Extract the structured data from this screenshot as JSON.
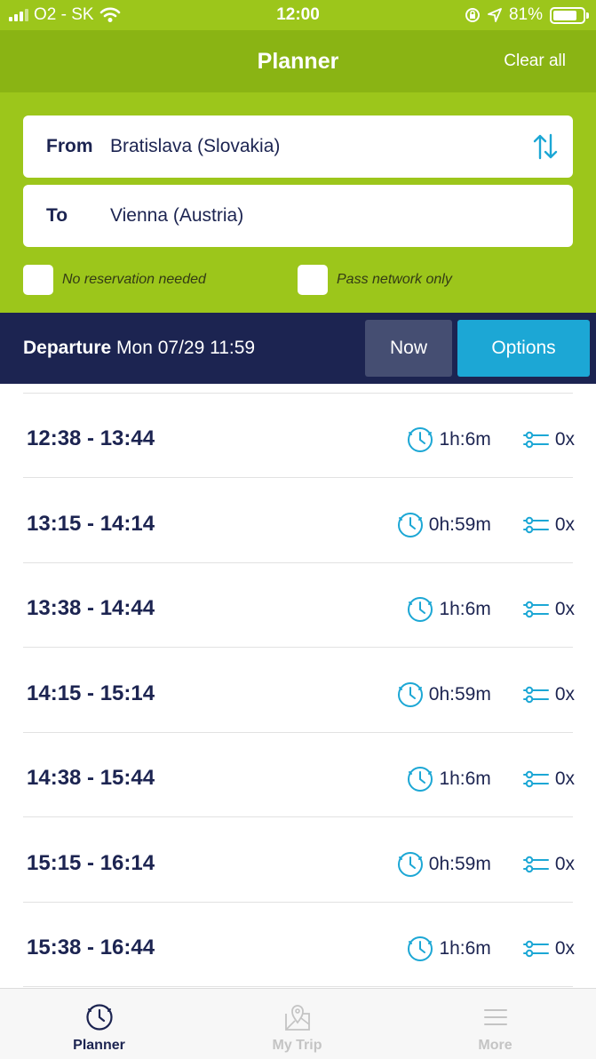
{
  "status_bar": {
    "carrier": "O2 - SK",
    "time": "12:00",
    "battery": "81%",
    "battery_level": 0.81
  },
  "header": {
    "title": "Planner",
    "clear_all": "Clear all"
  },
  "search": {
    "from_label": "From",
    "from_value": "Bratislava (Slovakia)",
    "to_label": "To",
    "to_value": "Vienna (Austria)"
  },
  "filters": {
    "no_reservation": "No reservation needed",
    "pass_network": "Pass network only"
  },
  "departure": {
    "label": "Departure",
    "value": "Mon 07/29 11:59",
    "now_button": "Now",
    "options_button": "Options"
  },
  "connections": [
    {
      "time": "12:38 - 13:44",
      "duration": "1h:6m",
      "transfers": "0x"
    },
    {
      "time": "13:15 - 14:14",
      "duration": "0h:59m",
      "transfers": "0x"
    },
    {
      "time": "13:38 - 14:44",
      "duration": "1h:6m",
      "transfers": "0x"
    },
    {
      "time": "14:15 - 15:14",
      "duration": "0h:59m",
      "transfers": "0x"
    },
    {
      "time": "14:38 - 15:44",
      "duration": "1h:6m",
      "transfers": "0x"
    },
    {
      "time": "15:15 - 16:14",
      "duration": "0h:59m",
      "transfers": "0x"
    },
    {
      "time": "15:38 - 16:44",
      "duration": "1h:6m",
      "transfers": "0x"
    }
  ],
  "tabs": [
    {
      "label": "Planner",
      "icon": "clock-icon",
      "active": true
    },
    {
      "label": "My Trip",
      "icon": "map-pin-icon",
      "active": false
    },
    {
      "label": "More",
      "icon": "menu-icon",
      "active": false
    }
  ],
  "colors": {
    "green": "#9cc61b",
    "header_green": "#8ab414",
    "navy": "#1c2451",
    "accent_blue": "#1ca7d5"
  }
}
